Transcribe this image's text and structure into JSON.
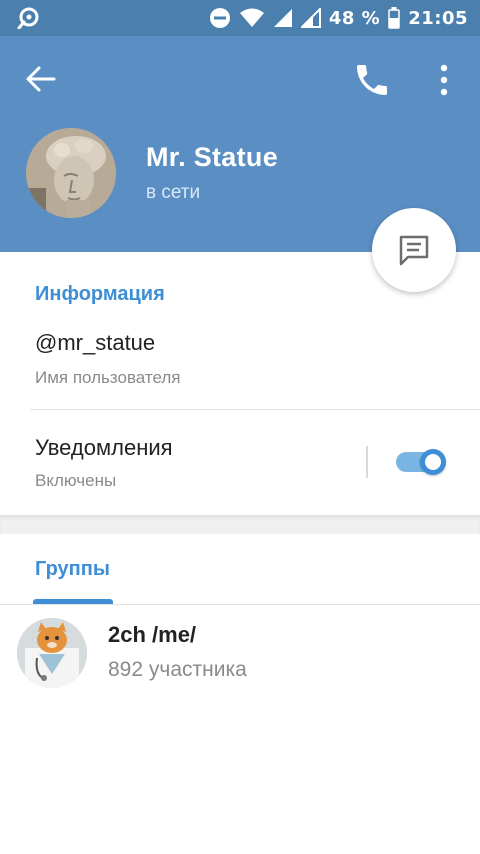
{
  "statusbar": {
    "battery_percent": "48 %",
    "time": "21:05"
  },
  "header": {
    "name": "Mr. Statue",
    "status": "в сети"
  },
  "info": {
    "section_title": "Информация",
    "username": "@mr_statue",
    "username_caption": "Имя пользователя",
    "notifications_label": "Уведомления",
    "notifications_state": "Включены",
    "notifications_enabled": true
  },
  "groups": {
    "tab_label": "Группы",
    "items": [
      {
        "name": "2ch /me/",
        "members": "892 участника"
      }
    ]
  },
  "colors": {
    "header": "#5b8fc4",
    "statusbar": "#4a7fae",
    "accent": "#3d8ed6"
  }
}
